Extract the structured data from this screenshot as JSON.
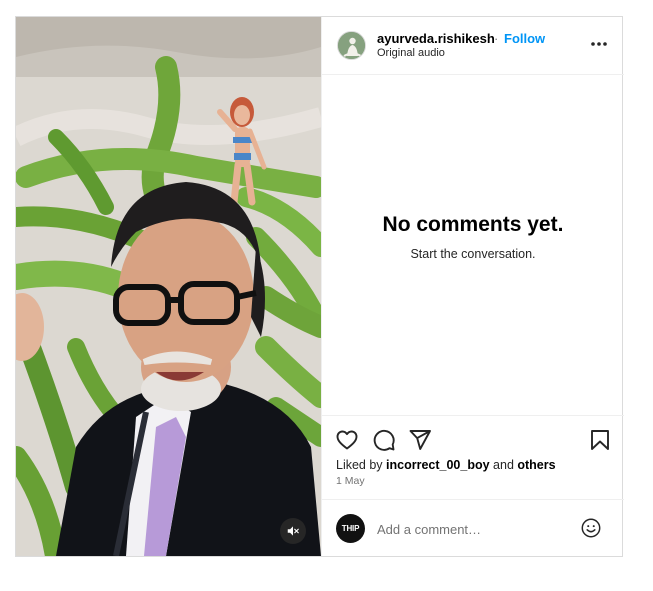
{
  "post": {
    "username": "ayurveda.rishikesh",
    "separator": "·",
    "follow_label": "Follow",
    "subtitle": "Original audio",
    "more_icon": "more-horizontal-icon"
  },
  "comments": {
    "empty_title": "No comments yet.",
    "empty_subtitle": "Start the conversation."
  },
  "actions": {
    "like_icon": "heart-icon",
    "comment_icon": "comment-icon",
    "share_icon": "send-icon",
    "save_icon": "bookmark-icon"
  },
  "likes": {
    "prefix": "Liked by ",
    "user": "incorrect_00_boy",
    "middle": " and ",
    "others": "others"
  },
  "date": "1 May",
  "comment_box": {
    "avatar_text": "THIP",
    "placeholder": "Add a comment…",
    "emoji_icon": "smiley-icon"
  },
  "media": {
    "mute_icon": "speaker-muted-icon"
  }
}
